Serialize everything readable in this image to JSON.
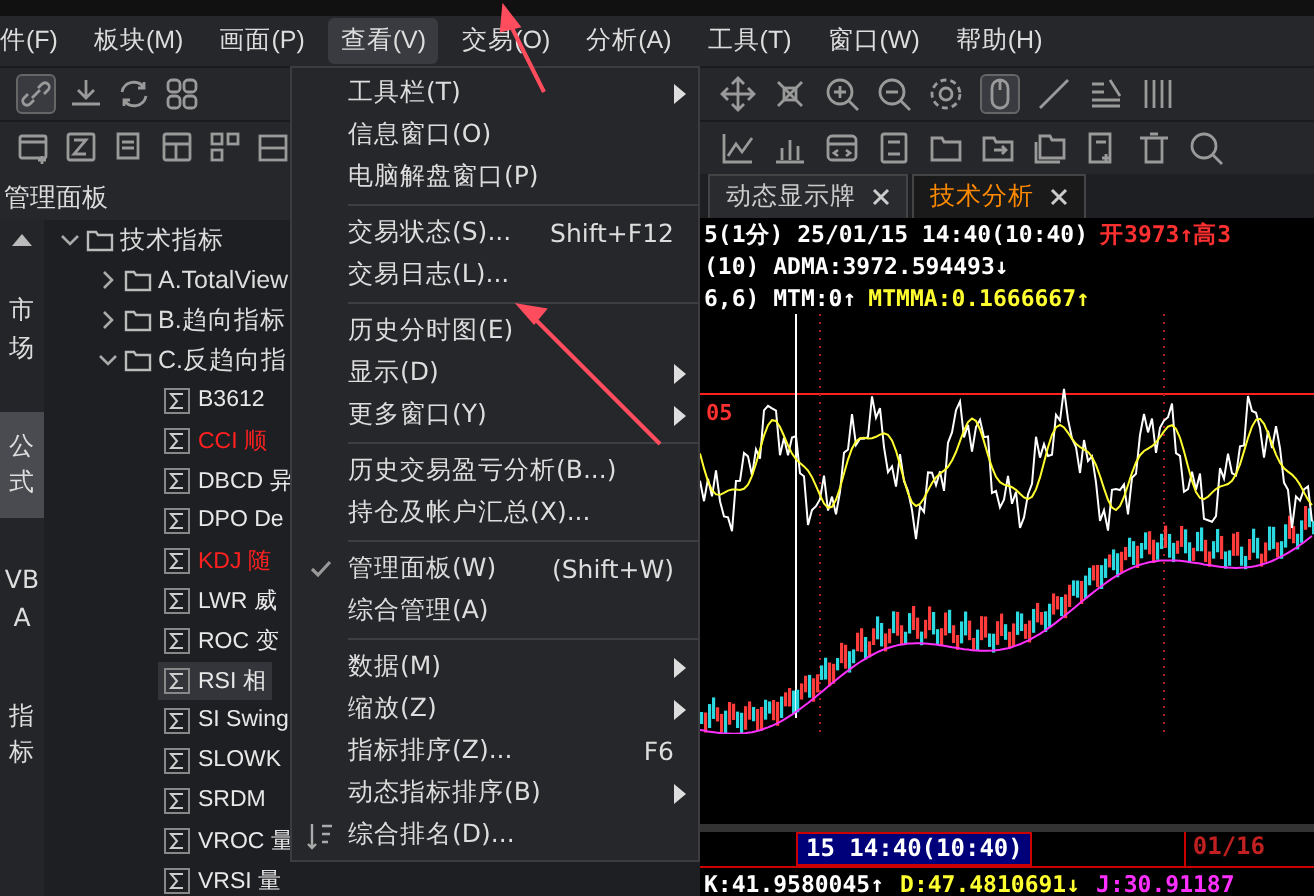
{
  "menubar": [
    {
      "label": "件(F)",
      "selected": false
    },
    {
      "label": "板块(M)",
      "selected": false
    },
    {
      "label": "画面(P)",
      "selected": false
    },
    {
      "label": "查看(V)",
      "selected": true
    },
    {
      "label": "交易(O)",
      "selected": false
    },
    {
      "label": "分析(A)",
      "selected": false
    },
    {
      "label": "工具(T)",
      "selected": false
    },
    {
      "label": "窗口(W)",
      "selected": false
    },
    {
      "label": "帮助(H)",
      "selected": false
    }
  ],
  "panel": {
    "title": "管理面板"
  },
  "side_tabs": [
    {
      "label": "市场",
      "selected": false
    },
    {
      "label": "公式",
      "selected": true
    },
    {
      "label": "VBA",
      "selected": false
    },
    {
      "label": "指标",
      "selected": false
    }
  ],
  "tree": [
    {
      "label": "技术指标",
      "expanded": true,
      "children": [
        {
          "label": "A.TotalView",
          "expanded": false
        },
        {
          "label": "B.趋向指标",
          "expanded": false
        },
        {
          "label": "C.反趋向指",
          "expanded": true,
          "children": [
            {
              "label": "B3612",
              "color": "#e8e8e8",
              "selected": false
            },
            {
              "label": "CCI 顺",
              "color": "#ff2020",
              "selected": false
            },
            {
              "label": "DBCD 异",
              "color": "#e8e8e8",
              "selected": false
            },
            {
              "label": "DPO De",
              "color": "#e8e8e8",
              "selected": false
            },
            {
              "label": "KDJ 随",
              "color": "#ff2020",
              "selected": false
            },
            {
              "label": "LWR 威",
              "color": "#e8e8e8",
              "selected": false
            },
            {
              "label": "ROC 变",
              "color": "#e8e8e8",
              "selected": false
            },
            {
              "label": "RSI 相",
              "color": "#e8e8e8",
              "selected": true
            },
            {
              "label": "SI Swing",
              "color": "#e8e8e8",
              "selected": false
            },
            {
              "label": "SLOWK",
              "color": "#e8e8e8",
              "selected": false
            },
            {
              "label": "SRDM",
              "color": "#e8e8e8",
              "selected": false
            },
            {
              "label": "VROC 量",
              "color": "#e8e8e8",
              "selected": false
            },
            {
              "label": "VRSI 量",
              "color": "#e8e8e8",
              "selected": false
            }
          ]
        }
      ]
    }
  ],
  "view_menu": [
    {
      "kind": "item",
      "label": "工具栏(T)",
      "submenu": true
    },
    {
      "kind": "item",
      "label": "信息窗口(O)"
    },
    {
      "kind": "item",
      "label": "电脑解盘窗口(P)"
    },
    {
      "kind": "separator"
    },
    {
      "kind": "item",
      "label": "交易状态(S)...",
      "shortcut": "Shift+F12"
    },
    {
      "kind": "item",
      "label": "交易日志(L)..."
    },
    {
      "kind": "separator"
    },
    {
      "kind": "item",
      "label": "历史分时图(E)"
    },
    {
      "kind": "item",
      "label": "显示(D)",
      "submenu": true
    },
    {
      "kind": "item",
      "label": "更多窗口(Y)",
      "submenu": true
    },
    {
      "kind": "separator"
    },
    {
      "kind": "item",
      "label": "历史交易盈亏分析(B...)"
    },
    {
      "kind": "item",
      "label": "持仓及帐户汇总(X)..."
    },
    {
      "kind": "separator"
    },
    {
      "kind": "item",
      "label": "管理面板(W)",
      "shortcut": "(Shift+W)",
      "checked": true
    },
    {
      "kind": "item",
      "label": "综合管理(A)",
      "checked": false
    },
    {
      "kind": "separator"
    },
    {
      "kind": "item",
      "label": "数据(M)",
      "submenu": true
    },
    {
      "kind": "item",
      "label": "缩放(Z)",
      "submenu": true
    },
    {
      "kind": "item",
      "label": "指标排序(Z)...",
      "shortcut": "F6"
    },
    {
      "kind": "item",
      "label": "动态指标排序(B)",
      "submenu": true
    },
    {
      "kind": "icon_item",
      "label": "综合排名(D)..."
    }
  ],
  "tabs": [
    {
      "label": "动态显示牌",
      "selected": false
    },
    {
      "label": "技术分析",
      "selected": true
    }
  ],
  "chart": {
    "header_lines": [
      [
        {
          "text": "5(1分) 25/01/15 14:40(10:40)",
          "color": "#ffffff"
        },
        {
          "text": "开3973↑高3",
          "color": "#ff3030"
        }
      ],
      [
        {
          "text": "(10) ADMA:3972.594493↓",
          "color": "#ffffff"
        }
      ],
      [
        {
          "text": "6,6) MTM:0↑",
          "color": "#ffffff"
        },
        {
          "text": "MTMMA:0.1666667↑",
          "color": "#ffff30"
        }
      ]
    ],
    "level_label": "05",
    "time_box": "15 14:40(10:40)",
    "date_label": "01/16",
    "footer": [
      {
        "text": "K:41.9580045↑",
        "color": "#ffffff"
      },
      {
        "text": "D:47.4810691↓",
        "color": "#ffff30"
      },
      {
        "text": "J:30.91187",
        "color": "#ff30ff"
      }
    ]
  }
}
